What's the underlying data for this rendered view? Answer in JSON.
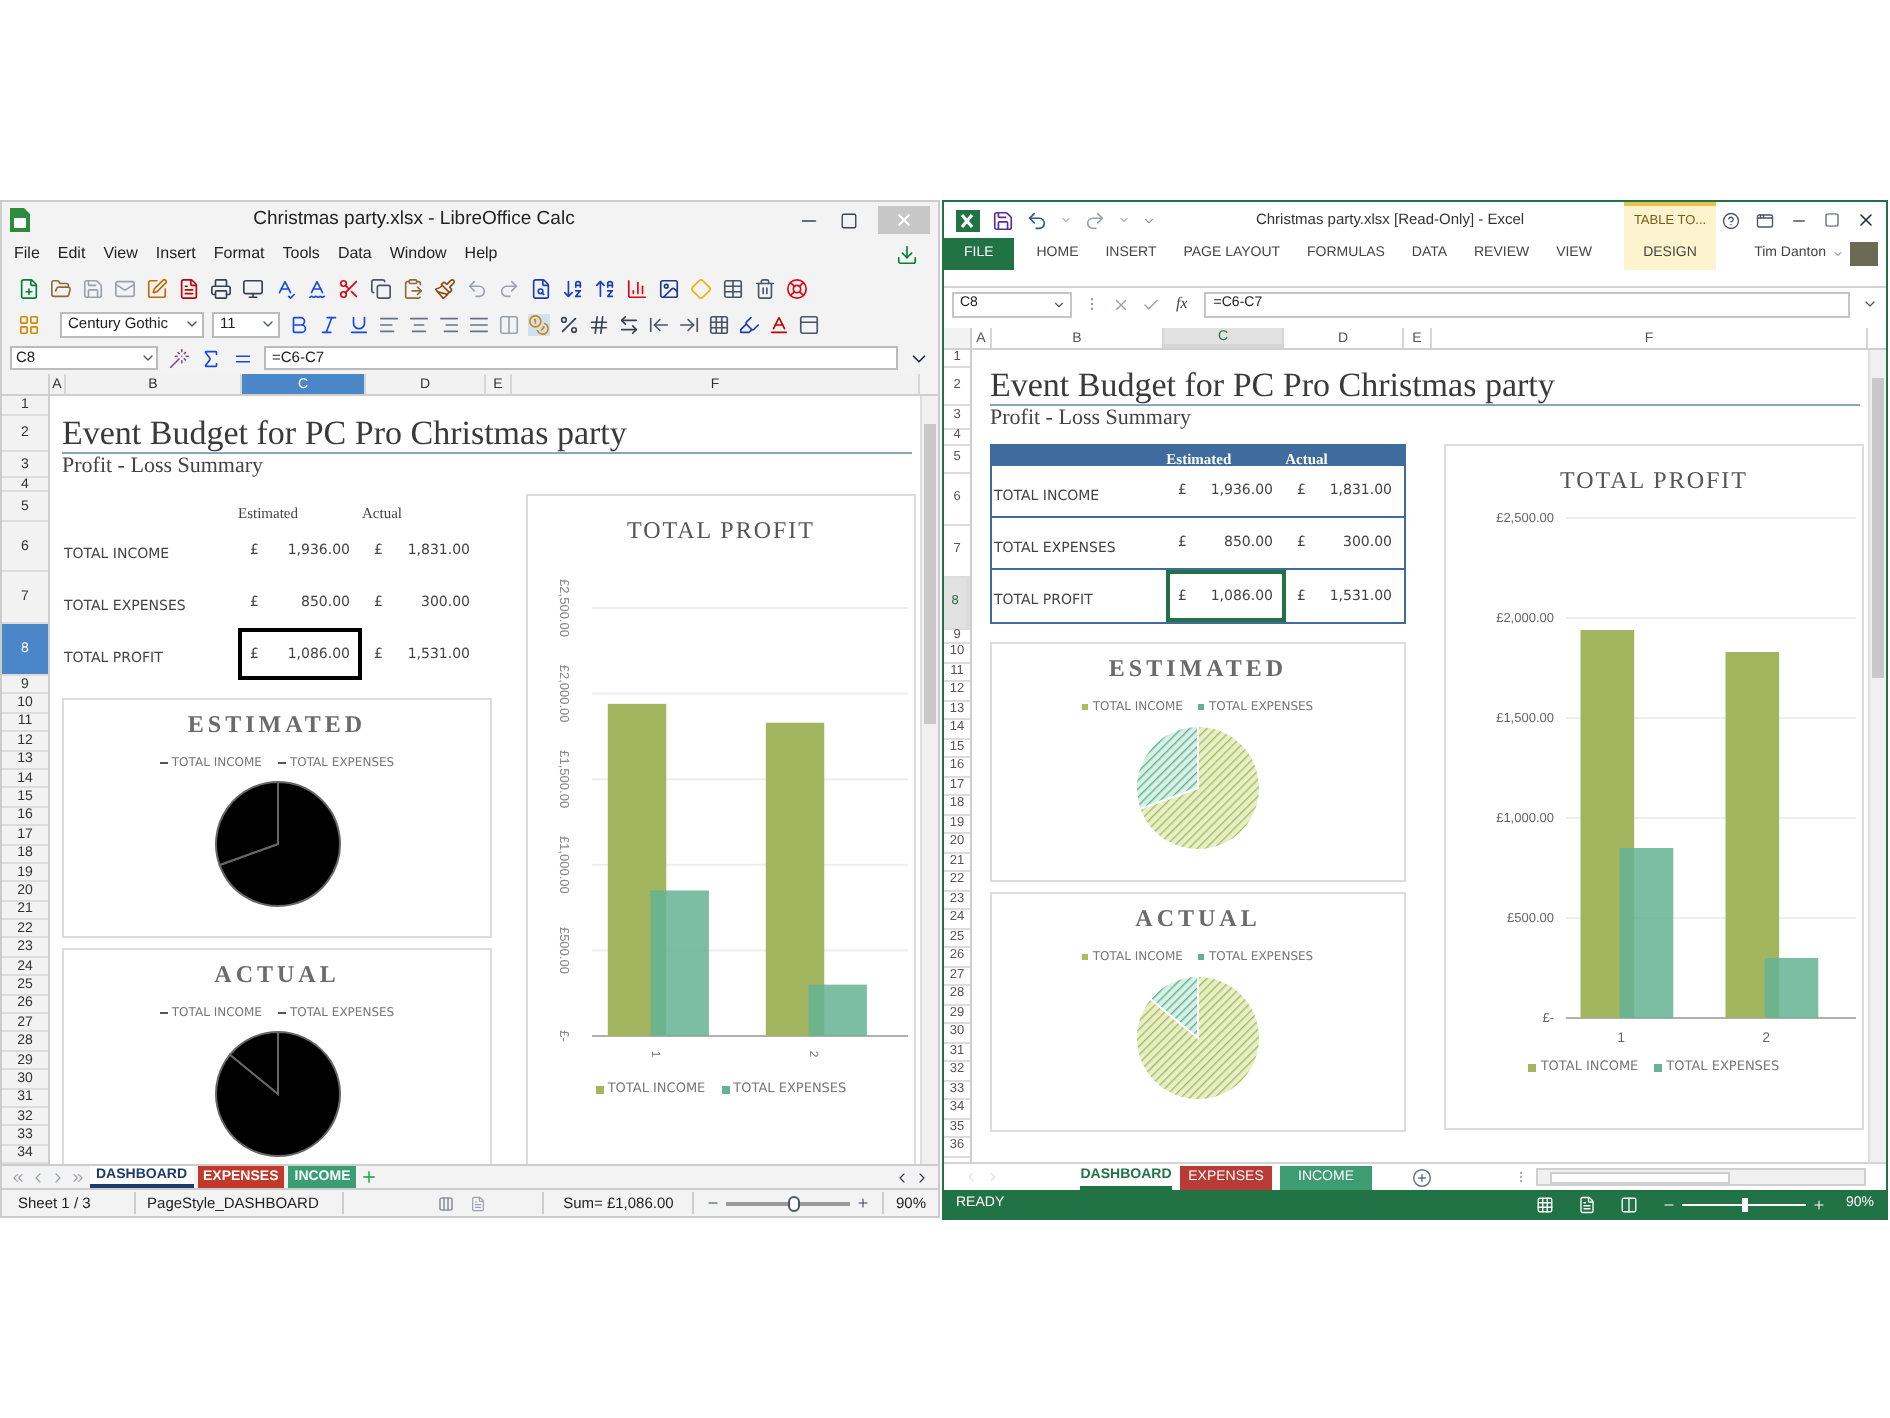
{
  "windows": [
    {
      "kind": "libreoffice",
      "title": "Christmas party.xlsx - LibreOffice Calc",
      "menu": [
        "File",
        "Edit",
        "View",
        "Insert",
        "Format",
        "Tools",
        "Data",
        "Window",
        "Help"
      ],
      "font_name": "Century Gothic",
      "font_size": "11",
      "name_box": "C8",
      "formula": "=C6-C7",
      "columns": [
        {
          "label": "A",
          "selected": false
        },
        {
          "label": "B",
          "selected": false
        },
        {
          "label": "C",
          "selected": true
        },
        {
          "label": "D",
          "selected": false
        },
        {
          "label": "E",
          "selected": false
        },
        {
          "label": "F",
          "selected": false
        }
      ],
      "rows": [
        {
          "label": "1",
          "selected": false
        },
        {
          "label": "2",
          "selected": false
        },
        {
          "label": "3",
          "selected": false
        },
        {
          "label": "4",
          "selected": false
        },
        {
          "label": "5",
          "selected": false
        },
        {
          "label": "6",
          "selected": false
        },
        {
          "label": "7",
          "selected": false
        },
        {
          "label": "8",
          "selected": true
        },
        {
          "label": "9",
          "selected": false
        },
        {
          "label": "10",
          "selected": false
        },
        {
          "label": "11",
          "selected": false
        },
        {
          "label": "12",
          "selected": false
        },
        {
          "label": "13",
          "selected": false
        },
        {
          "label": "14",
          "selected": false
        },
        {
          "label": "15",
          "selected": false
        },
        {
          "label": "16",
          "selected": false
        },
        {
          "label": "17",
          "selected": false
        },
        {
          "label": "18",
          "selected": false
        },
        {
          "label": "19",
          "selected": false
        },
        {
          "label": "20",
          "selected": false
        },
        {
          "label": "21",
          "selected": false
        },
        {
          "label": "22",
          "selected": false
        },
        {
          "label": "23",
          "selected": false
        },
        {
          "label": "24",
          "selected": false
        },
        {
          "label": "25",
          "selected": false
        },
        {
          "label": "26",
          "selected": false
        },
        {
          "label": "27",
          "selected": false
        },
        {
          "label": "28",
          "selected": false
        },
        {
          "label": "29",
          "selected": false
        },
        {
          "label": "30",
          "selected": false
        },
        {
          "label": "31",
          "selected": false
        },
        {
          "label": "32",
          "selected": false
        },
        {
          "label": "33",
          "selected": false
        },
        {
          "label": "34",
          "selected": false
        }
      ],
      "sheet": {
        "title": "Event Budget for PC Pro Christmas party",
        "subtitle": "Profit - Loss Summary",
        "headers": [
          "Estimated",
          "Actual"
        ],
        "table": [
          {
            "label": "TOTAL INCOME",
            "est_currency": "£",
            "estimated": "1,936.00",
            "act_currency": "£",
            "actual": "1,831.00",
            "selected": false
          },
          {
            "label": "TOTAL EXPENSES",
            "est_currency": "£",
            "estimated": "850.00",
            "act_currency": "£",
            "actual": "300.00",
            "selected": false
          },
          {
            "label": "TOTAL PROFIT",
            "est_currency": "£",
            "estimated": "1,086.00",
            "act_currency": "£",
            "actual": "1,531.00",
            "selected": true
          }
        ],
        "pies": [
          {
            "title": "ESTIMATED",
            "legend": [
              "TOTAL INCOME",
              "TOTAL EXPENSES"
            ]
          },
          {
            "title": "ACTUAL",
            "legend": [
              "TOTAL INCOME",
              "TOTAL EXPENSES"
            ]
          }
        ],
        "chart_data": {
          "type": "bar",
          "title": "TOTAL PROFIT",
          "categories": [
            "1",
            "2"
          ],
          "series": [
            {
              "name": "TOTAL INCOME",
              "color": "#a3b55e",
              "values": [
                1940,
                1830
              ]
            },
            {
              "name": "TOTAL EXPENSES",
              "color": "#64b394",
              "values": [
                850,
                300
              ]
            }
          ],
          "ylim": [
            0,
            2500
          ],
          "yticks": [
            {
              "value": 0,
              "label": "£-"
            },
            {
              "value": 500,
              "label": "£500.00"
            },
            {
              "value": 1000,
              "label": "£1,000.00"
            },
            {
              "value": 1500,
              "label": "£1,500.00"
            },
            {
              "value": 2000,
              "label": "£2,000.00"
            },
            {
              "value": 2500,
              "label": "£2,500.00"
            }
          ],
          "grid": true,
          "legend": true
        }
      },
      "tabs": [
        {
          "label": "DASHBOARD",
          "selected": true,
          "color": "#ffffff"
        },
        {
          "label": "EXPENSES",
          "selected": false,
          "color": "#c0392b"
        },
        {
          "label": "INCOME",
          "selected": false,
          "color": "#3a9e74"
        }
      ],
      "status": {
        "sheet": "Sheet 1 / 3",
        "page_style": "PageStyle_DASHBOARD",
        "sum": "Sum= £1,086.00",
        "zoom": "90%",
        "zoom_slider": {
          "level": 0.55
        }
      }
    },
    {
      "kind": "excel",
      "title": "Christmas party.xlsx  [Read-Only] - Excel",
      "context_header": "TABLE TO...",
      "ribbon_tabs": [
        {
          "label": "FILE",
          "kind": "file",
          "selected": false
        },
        {
          "label": "HOME",
          "kind": "normal",
          "selected": false
        },
        {
          "label": "INSERT",
          "kind": "normal",
          "selected": false
        },
        {
          "label": "PAGE LAYOUT",
          "kind": "normal",
          "selected": false
        },
        {
          "label": "FORMULAS",
          "kind": "normal",
          "selected": false
        },
        {
          "label": "DATA",
          "kind": "normal",
          "selected": false
        },
        {
          "label": "REVIEW",
          "kind": "normal",
          "selected": false
        },
        {
          "label": "VIEW",
          "kind": "normal",
          "selected": false
        },
        {
          "label": "DESIGN",
          "kind": "contextual",
          "selected": false
        }
      ],
      "user": "Tim Danton",
      "name_box": "C8",
      "fx": "fx",
      "formula": "=C6-C7",
      "columns": [
        {
          "label": "A",
          "selected": false
        },
        {
          "label": "B",
          "selected": false
        },
        {
          "label": "C",
          "selected": true
        },
        {
          "label": "D",
          "selected": false
        },
        {
          "label": "E",
          "selected": false
        },
        {
          "label": "F",
          "selected": false
        }
      ],
      "rows": [
        {
          "label": "1",
          "selected": false
        },
        {
          "label": "2",
          "selected": false
        },
        {
          "label": "3",
          "selected": false
        },
        {
          "label": "4",
          "selected": false
        },
        {
          "label": "5",
          "selected": false
        },
        {
          "label": "6",
          "selected": false
        },
        {
          "label": "7",
          "selected": false
        },
        {
          "label": "8",
          "selected": true
        },
        {
          "label": "9",
          "selected": false
        },
        {
          "label": "10",
          "selected": false
        },
        {
          "label": "11",
          "selected": false
        },
        {
          "label": "12",
          "selected": false
        },
        {
          "label": "13",
          "selected": false
        },
        {
          "label": "14",
          "selected": false
        },
        {
          "label": "15",
          "selected": false
        },
        {
          "label": "16",
          "selected": false
        },
        {
          "label": "17",
          "selected": false
        },
        {
          "label": "18",
          "selected": false
        },
        {
          "label": "19",
          "selected": false
        },
        {
          "label": "20",
          "selected": false
        },
        {
          "label": "21",
          "selected": false
        },
        {
          "label": "22",
          "selected": false
        },
        {
          "label": "23",
          "selected": false
        },
        {
          "label": "24",
          "selected": false
        },
        {
          "label": "25",
          "selected": false
        },
        {
          "label": "26",
          "selected": false
        },
        {
          "label": "27",
          "selected": false
        },
        {
          "label": "28",
          "selected": false
        },
        {
          "label": "29",
          "selected": false
        },
        {
          "label": "30",
          "selected": false
        },
        {
          "label": "31",
          "selected": false
        },
        {
          "label": "32",
          "selected": false
        },
        {
          "label": "33",
          "selected": false
        },
        {
          "label": "34",
          "selected": false
        },
        {
          "label": "35",
          "selected": false
        },
        {
          "label": "36",
          "selected": false
        }
      ],
      "sheet": {
        "title": "Event Budget for PC Pro Christmas party",
        "subtitle": "Profit - Loss Summary",
        "headers": [
          "Estimated",
          "Actual"
        ],
        "table": [
          {
            "label": "TOTAL INCOME",
            "est_currency": "£",
            "estimated": "1,936.00",
            "act_currency": "£",
            "actual": "1,831.00",
            "selected": false
          },
          {
            "label": "TOTAL EXPENSES",
            "est_currency": "£",
            "estimated": "850.00",
            "act_currency": "£",
            "actual": "300.00",
            "selected": false
          },
          {
            "label": "TOTAL PROFIT",
            "est_currency": "£",
            "estimated": "1,086.00",
            "act_currency": "£",
            "actual": "1,531.00",
            "selected": true
          }
        ],
        "pies": [
          {
            "title": "ESTIMATED",
            "legend": [
              "TOTAL INCOME",
              "TOTAL EXPENSES"
            ]
          },
          {
            "title": "ACTUAL",
            "legend": [
              "TOTAL INCOME",
              "TOTAL EXPENSES"
            ]
          }
        ],
        "chart_data": {
          "type": "bar",
          "title": "TOTAL PROFIT",
          "categories": [
            "1",
            "2"
          ],
          "series": [
            {
              "name": "TOTAL INCOME",
              "color": "#a3b55e",
              "values": [
                1940,
                1830
              ]
            },
            {
              "name": "TOTAL EXPENSES",
              "color": "#64b394",
              "values": [
                850,
                300
              ]
            }
          ],
          "ylim": [
            0,
            2500
          ],
          "yticks": [
            {
              "value": 0,
              "label": "£-"
            },
            {
              "value": 500,
              "label": "£500.00"
            },
            {
              "value": 1000,
              "label": "£1,000.00"
            },
            {
              "value": 1500,
              "label": "£1,500.00"
            },
            {
              "value": 2000,
              "label": "£2,000.00"
            },
            {
              "value": 2500,
              "label": "£2,500.00"
            }
          ],
          "grid": true,
          "legend": true
        }
      },
      "tabs": [
        {
          "label": "DASHBOARD",
          "selected": true,
          "color": "#ffffff"
        },
        {
          "label": "EXPENSES",
          "selected": false,
          "color": "#b83b36"
        },
        {
          "label": "INCOME",
          "selected": false,
          "color": "#3d9c72"
        }
      ],
      "status": {
        "mode": "READY",
        "zoom": "90%",
        "zoom_slider": {
          "level": 0.5
        }
      }
    }
  ]
}
